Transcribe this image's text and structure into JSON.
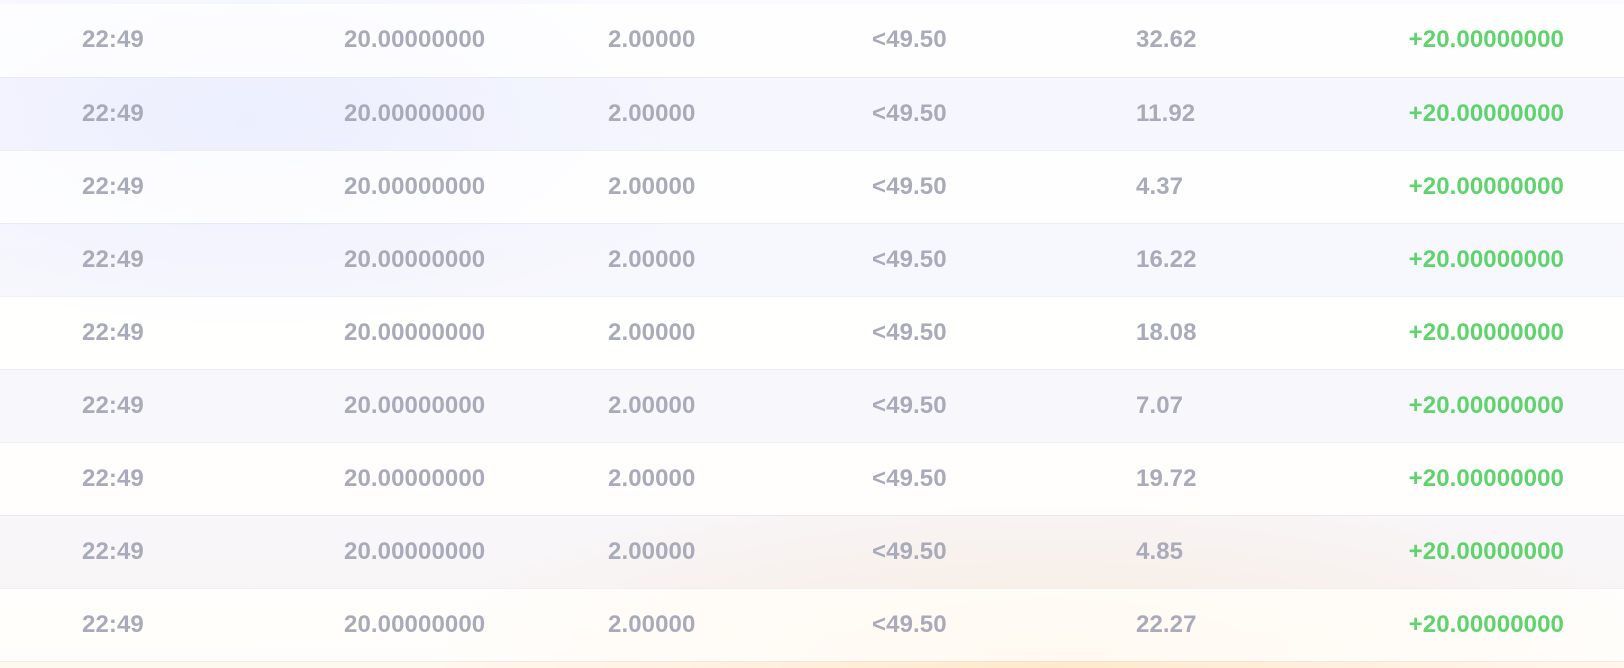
{
  "bets": [
    {
      "time": "22:49",
      "bet_amount": "20.00000000",
      "multiplier": "2.00000",
      "target": "<49.50",
      "roll": "32.62",
      "profit": "+20.00000000"
    },
    {
      "time": "22:49",
      "bet_amount": "20.00000000",
      "multiplier": "2.00000",
      "target": "<49.50",
      "roll": "11.92",
      "profit": "+20.00000000"
    },
    {
      "time": "22:49",
      "bet_amount": "20.00000000",
      "multiplier": "2.00000",
      "target": "<49.50",
      "roll": "4.37",
      "profit": "+20.00000000"
    },
    {
      "time": "22:49",
      "bet_amount": "20.00000000",
      "multiplier": "2.00000",
      "target": "<49.50",
      "roll": "16.22",
      "profit": "+20.00000000"
    },
    {
      "time": "22:49",
      "bet_amount": "20.00000000",
      "multiplier": "2.00000",
      "target": "<49.50",
      "roll": "18.08",
      "profit": "+20.00000000"
    },
    {
      "time": "22:49",
      "bet_amount": "20.00000000",
      "multiplier": "2.00000",
      "target": "<49.50",
      "roll": "7.07",
      "profit": "+20.00000000"
    },
    {
      "time": "22:49",
      "bet_amount": "20.00000000",
      "multiplier": "2.00000",
      "target": "<49.50",
      "roll": "19.72",
      "profit": "+20.00000000"
    },
    {
      "time": "22:49",
      "bet_amount": "20.00000000",
      "multiplier": "2.00000",
      "target": "<49.50",
      "roll": "4.85",
      "profit": "+20.00000000"
    },
    {
      "time": "22:49",
      "bet_amount": "20.00000000",
      "multiplier": "2.00000",
      "target": "<49.50",
      "roll": "22.27",
      "profit": "+20.00000000"
    }
  ],
  "colors": {
    "text_muted": "#a9abbb",
    "profit_positive": "#5fd36c"
  }
}
